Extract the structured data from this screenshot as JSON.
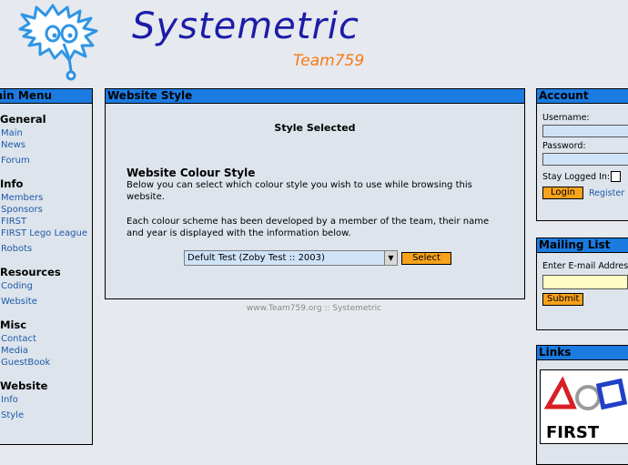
{
  "header": {
    "site_title": "Systemetric",
    "team_label": "Team759"
  },
  "menu": {
    "title": "Main Menu",
    "sections": [
      {
        "heading": "General",
        "links": [
          "Main",
          "News",
          "Forum"
        ]
      },
      {
        "heading": "Info",
        "links": [
          "Members",
          "Sponsors",
          "FIRST",
          "FIRST Lego League",
          "Robots"
        ]
      },
      {
        "heading": "Resources",
        "links": [
          "Coding",
          "Website"
        ]
      },
      {
        "heading": "Misc",
        "links": [
          "Contact",
          "Media",
          "GuestBook"
        ]
      },
      {
        "heading": "Website",
        "links": [
          "Info",
          "Style"
        ]
      }
    ]
  },
  "main": {
    "title": "Website Style",
    "status": "Style Selected",
    "heading": "Website Colour Style",
    "desc1": "Below you can select which colour style you wish to use while browsing this website.",
    "desc2": "Each colour scheme has been developed by a member of the team, their name and year is displayed with the information below.",
    "select_value": "Defult Test (Zoby Test :: 2003)",
    "select_button": "Select"
  },
  "footer": {
    "text": "www.Team759.org :: Systemetric"
  },
  "account": {
    "title": "Account",
    "username_label": "Username:",
    "password_label": "Password:",
    "stay_label": "Stay Logged In:",
    "login_button": "Login",
    "register_link": "Register"
  },
  "mailing": {
    "title": "Mailing List",
    "email_label": "Enter E-mail Address",
    "submit_button": "Submit"
  },
  "links": {
    "title": "Links",
    "logo_text": "FIRST"
  },
  "colors": {
    "header_bar": "#1b7be0",
    "panel_bg": "#dde4ec",
    "button": "#f7a21a",
    "link": "#1e5aa8",
    "brand_blue": "#1c1ca8",
    "brand_orange": "#f57a15"
  }
}
